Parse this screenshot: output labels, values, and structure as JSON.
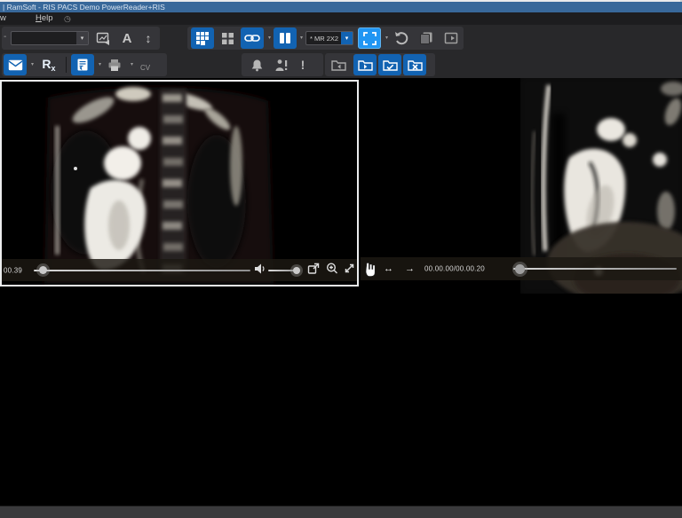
{
  "window": {
    "title": "| RamSoft - RIS PACS Demo PowerReader+RIS"
  },
  "menu": {
    "clipped_item": "w",
    "help": {
      "accel": "H",
      "rest": "elp"
    },
    "help_badge": "◷"
  },
  "icons": {
    "chevron_down": "▾"
  },
  "toolbar_primary": {
    "clipped_dash": "-",
    "preset_combo_value": "",
    "text_tool_label": "A",
    "scroll_tool_glyph": "↕",
    "layout_combo_value": "* MR 2X2"
  },
  "toolbar_secondary": {
    "rx": {
      "r": "R",
      "x": "x"
    },
    "cv_label": "CV",
    "alert_glyph": "!"
  },
  "viewers": {
    "left": {
      "time_label": "00.39",
      "selected": true
    },
    "right": {
      "time_label": "00.00.00/00.00.20",
      "loop_arrow": "↔",
      "play_direction_arrow": "→"
    }
  },
  "colors": {
    "title_bar": "#38689a",
    "accent_blue": "#1263b2",
    "bright_blue": "#2196f3",
    "toolbar_bg": "#28282a",
    "status_bar": "#3a3a3c",
    "viewer_border": "#ecedee"
  }
}
